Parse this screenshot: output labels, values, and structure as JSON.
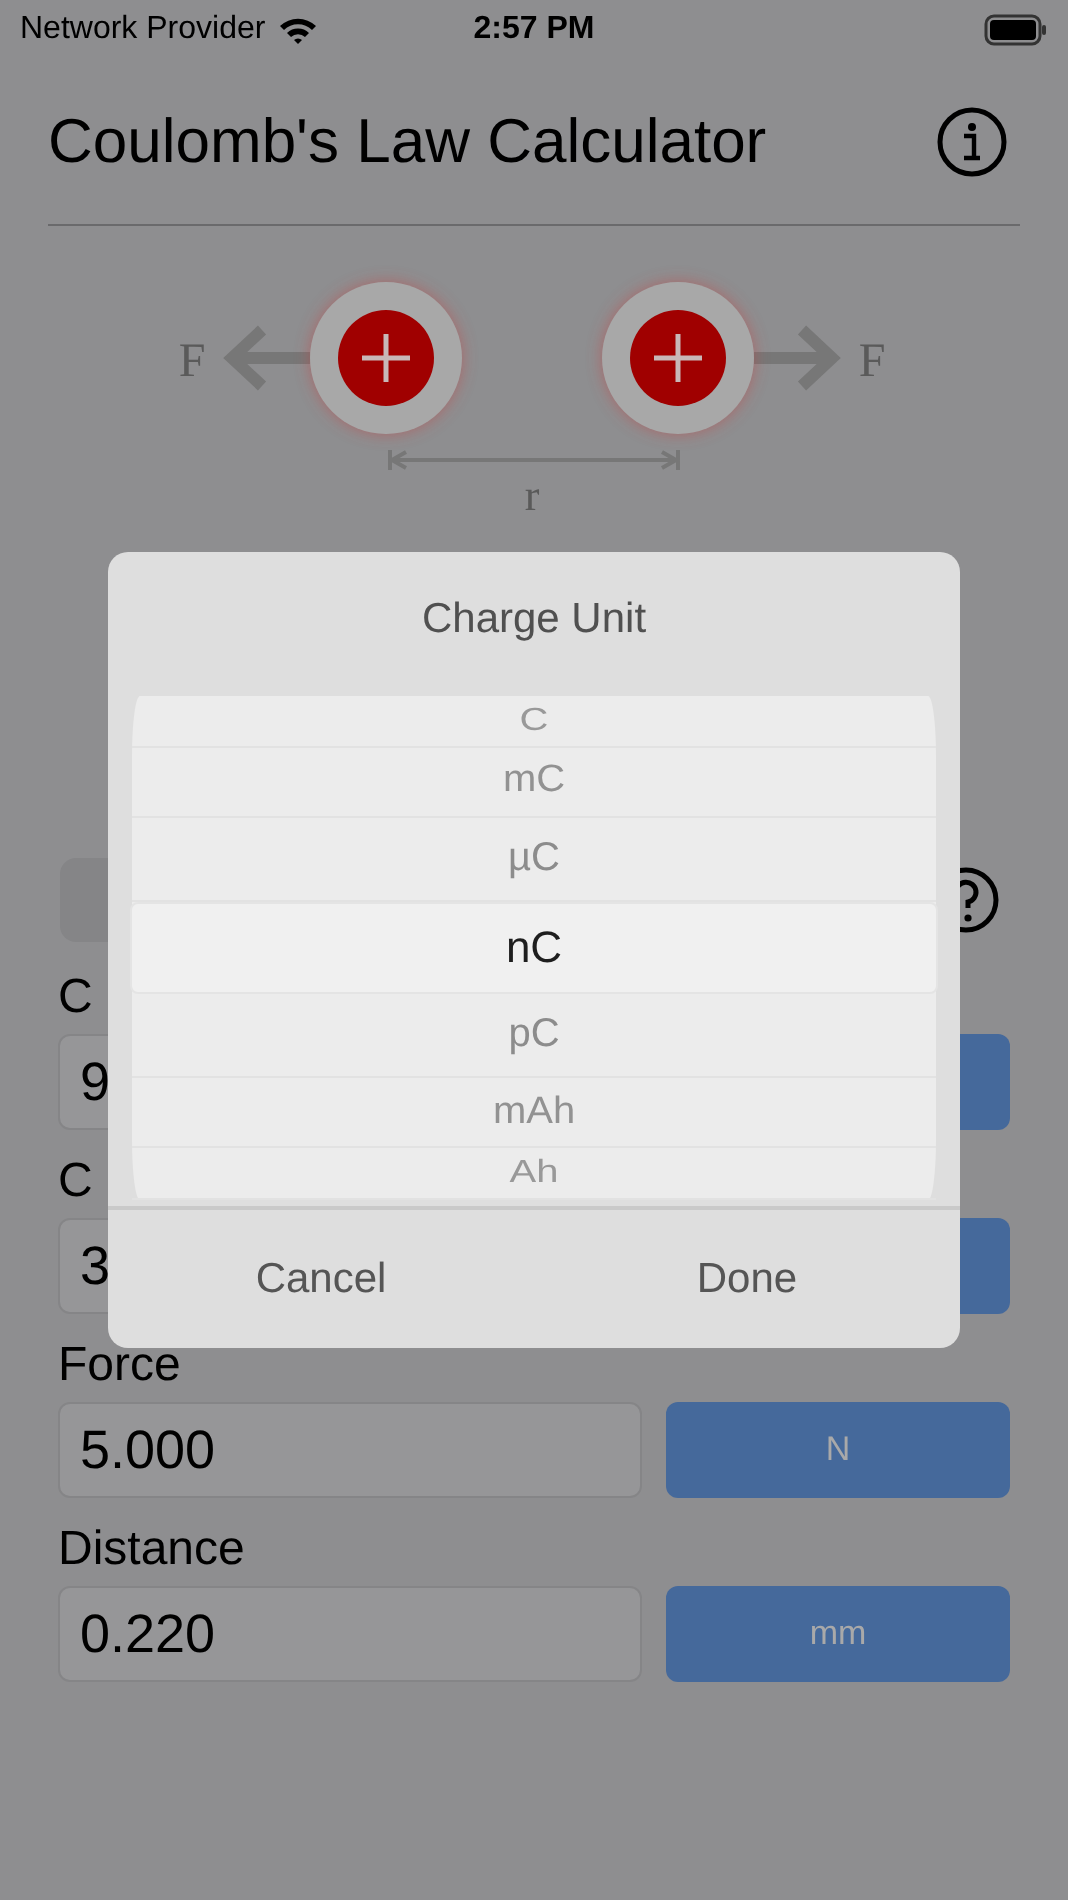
{
  "status_bar": {
    "carrier": "Network Provider",
    "time": "2:57 PM"
  },
  "header": {
    "title": "Coulomb's Law Calculator"
  },
  "diagram": {
    "force_label_left": "F",
    "force_label_right": "F",
    "distance_label": "r"
  },
  "fields": [
    {
      "label": "C",
      "value": "9"
    },
    {
      "label": "C",
      "value": "3"
    },
    {
      "label": "Force",
      "value": "5.000",
      "unit": "N"
    },
    {
      "label": "Distance",
      "value": "0.220",
      "unit": "mm"
    }
  ],
  "picker": {
    "title": "Charge Unit",
    "items": [
      {
        "label": "C",
        "selected": false
      },
      {
        "label": "mC",
        "selected": false
      },
      {
        "label": "µC",
        "selected": false
      },
      {
        "label": "nC",
        "selected": true
      },
      {
        "label": "pC",
        "selected": false
      },
      {
        "label": "mAh",
        "selected": false
      },
      {
        "label": "Ah",
        "selected": false
      }
    ],
    "buttons": [
      "Cancel",
      "Done"
    ]
  }
}
